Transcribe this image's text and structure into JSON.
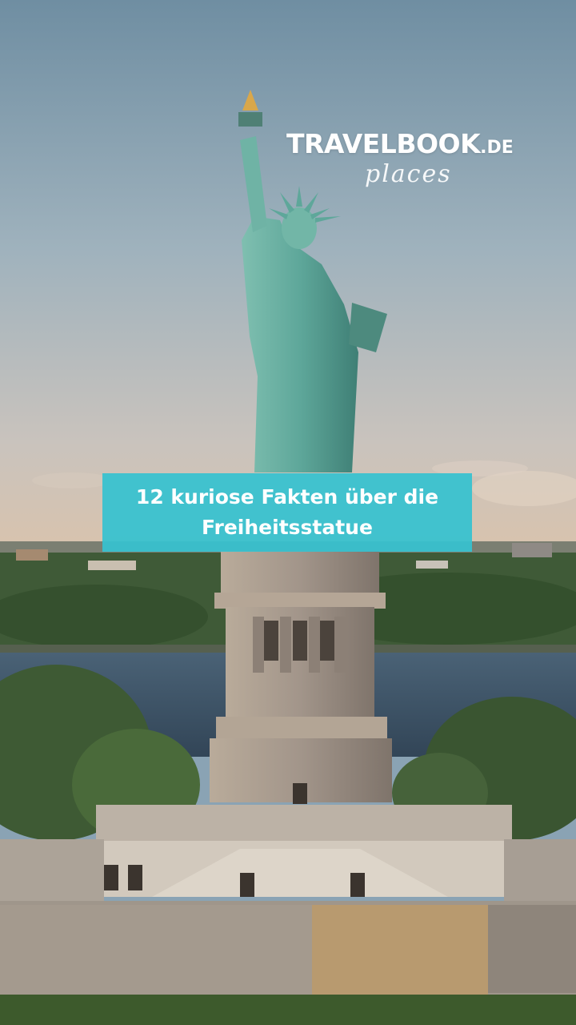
{
  "brand": {
    "name": "TRAVELBOOK",
    "suffix": ".DE",
    "subtitle": "places"
  },
  "headline": "12 kuriose Fakten über die Freiheitsstatue",
  "colors": {
    "banner": "#36c2d0",
    "sky_top": "#6f8fa3",
    "statue": "#5ea79a",
    "water": "#3c5366"
  }
}
